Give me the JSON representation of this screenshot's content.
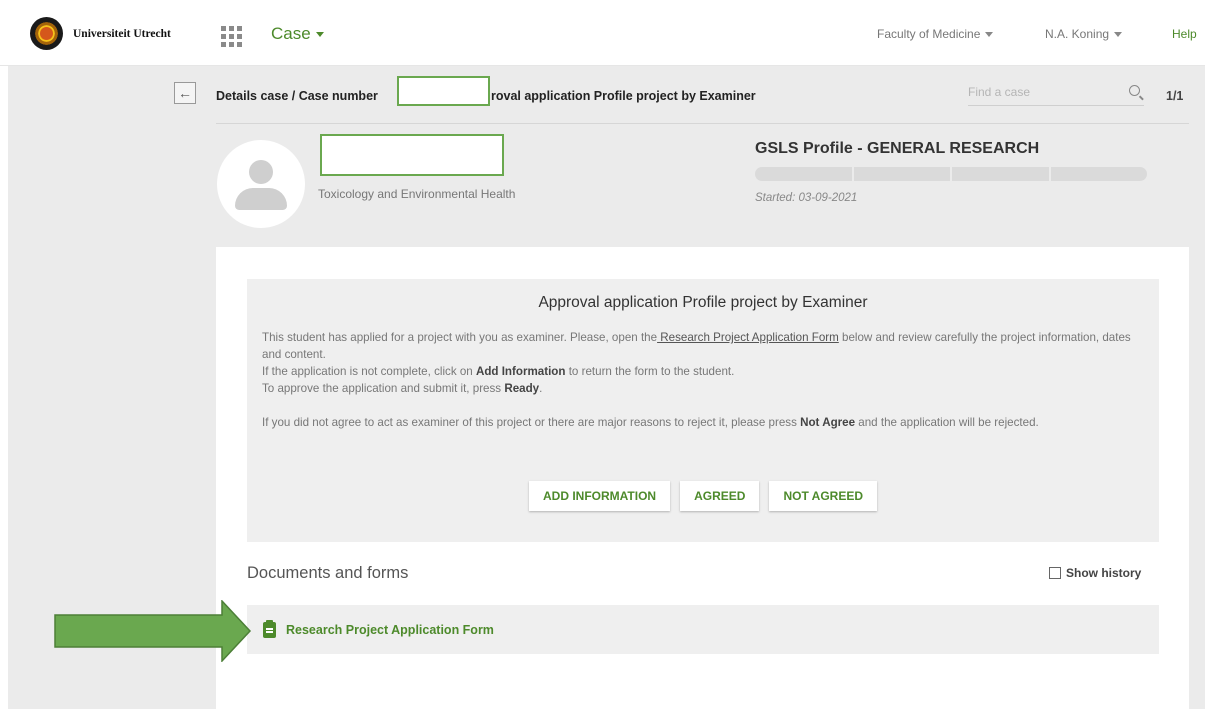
{
  "header": {
    "logo_text": "Universiteit Utrecht",
    "case_menu": "Case",
    "faculty": "Faculty of Medicine",
    "user": "N.A. Koning",
    "help": "Help"
  },
  "toolbar": {
    "breadcrumb": "Details case / Case number",
    "breadcrumb_tail": "roval application Profile project by Examiner",
    "search_placeholder": "Find a case",
    "pager": "1/1"
  },
  "student": {
    "department": "Toxicology and Environmental Health"
  },
  "profile": {
    "title": "GSLS Profile - GENERAL RESEARCH",
    "started": "Started: 03-09-2021"
  },
  "approval": {
    "title": "Approval application Profile project by Examiner",
    "p1_a": "This student has applied for a project with you as examiner. Please, open the",
    "p1_link": " Research Project Application Form",
    "p1_b": " below and review carefully the project information, dates and content.",
    "p2_a": "If the application is not complete, click on ",
    "p2_bold": "Add Information",
    "p2_b": " to return the form to the student.",
    "p3_a": "To approve the application and submit it, press ",
    "p3_bold": "Ready",
    "p3_b": ".",
    "p4_a": "If you did not agree to act as examiner of this project or there are major reasons to reject it, please press ",
    "p4_bold": "Not Agree",
    "p4_b": " and the application will be rejected.",
    "buttons": {
      "add_information": "ADD INFORMATION",
      "agreed": "AGREED",
      "not_agreed": "NOT AGREED"
    }
  },
  "documents": {
    "title": "Documents and forms",
    "show_history": "Show history",
    "form_link": "Research Project Application Form"
  },
  "colors": {
    "accent_green": "#4d8a2b",
    "annotation_green": "#6aa84f"
  }
}
